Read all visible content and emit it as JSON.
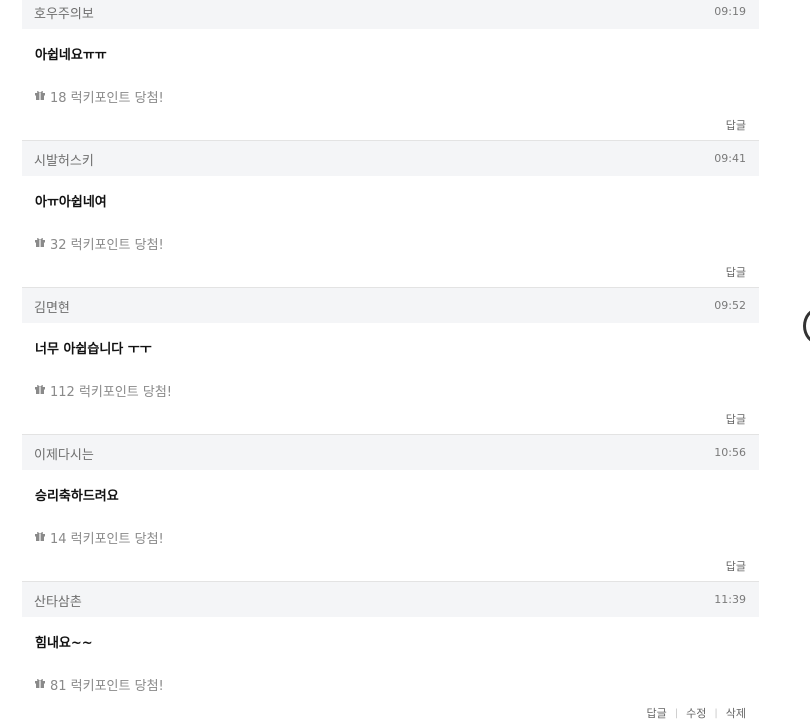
{
  "comments": [
    {
      "author": "호우주의보",
      "time": "09:19",
      "text": "아쉽네요ㅠㅠ",
      "lucky": "18 럭키포인트 당첨!",
      "actions": [
        "답글"
      ]
    },
    {
      "author": "시발허스키",
      "time": "09:41",
      "text": "아ㅠ아쉽네여",
      "lucky": "32 럭키포인트 당첨!",
      "actions": [
        "답글"
      ]
    },
    {
      "author": "김면현",
      "time": "09:52",
      "text": "너무 아쉽습니다 ㅜㅜ",
      "lucky": "112 럭키포인트 당첨!",
      "actions": [
        "답글"
      ]
    },
    {
      "author": "이제다시는",
      "time": "10:56",
      "text": "승리축하드려요",
      "lucky": "14 럭키포인트 당첨!",
      "actions": [
        "답글"
      ]
    },
    {
      "author": "산타삼촌",
      "time": "11:39",
      "text": "힘내요~~",
      "lucky": "81 럭키포인트 당첨!",
      "actions": [
        "답글",
        "수정",
        "삭제"
      ]
    }
  ],
  "icons": {
    "lucky": "gift-icon"
  },
  "colors": {
    "header_bg": "#f4f5f7",
    "text": "#111111",
    "muted": "#8a8a8a"
  }
}
